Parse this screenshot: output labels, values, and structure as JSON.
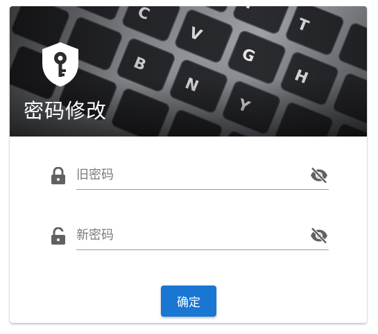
{
  "header": {
    "title": "密码修改",
    "image": "keyboard-banner",
    "icon": "shield-key-icon"
  },
  "form": {
    "old_password": {
      "placeholder": "旧密码",
      "value": "",
      "leading_icon": "lock-closed-icon",
      "trailing_icon": "eye-off-icon"
    },
    "new_password": {
      "placeholder": "新密码",
      "value": "",
      "leading_icon": "lock-open-icon",
      "trailing_icon": "eye-off-icon"
    },
    "submit_label": "确定"
  },
  "colors": {
    "accent": "#1976d2",
    "icon": "#616161",
    "underline": "#9a9a9a",
    "title_text": "#ffffff"
  }
}
